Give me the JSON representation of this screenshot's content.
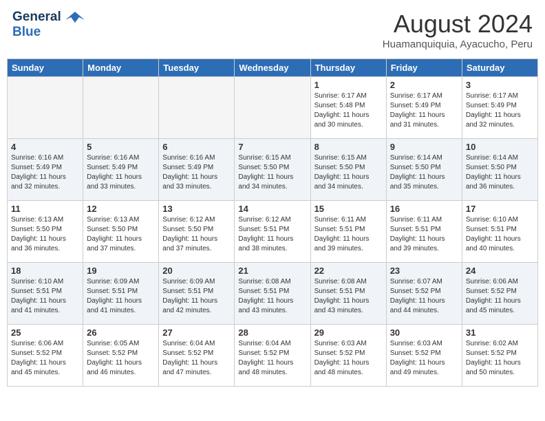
{
  "header": {
    "logo_line1": "General",
    "logo_line2": "Blue",
    "title": "August 2024",
    "subtitle": "Huamanquiquia, Ayacucho, Peru"
  },
  "calendar": {
    "headers": [
      "Sunday",
      "Monday",
      "Tuesday",
      "Wednesday",
      "Thursday",
      "Friday",
      "Saturday"
    ],
    "weeks": [
      [
        {
          "day": "",
          "info": ""
        },
        {
          "day": "",
          "info": ""
        },
        {
          "day": "",
          "info": ""
        },
        {
          "day": "",
          "info": ""
        },
        {
          "day": "1",
          "info": "Sunrise: 6:17 AM\nSunset: 5:48 PM\nDaylight: 11 hours and 30 minutes."
        },
        {
          "day": "2",
          "info": "Sunrise: 6:17 AM\nSunset: 5:49 PM\nDaylight: 11 hours and 31 minutes."
        },
        {
          "day": "3",
          "info": "Sunrise: 6:17 AM\nSunset: 5:49 PM\nDaylight: 11 hours and 32 minutes."
        }
      ],
      [
        {
          "day": "4",
          "info": "Sunrise: 6:16 AM\nSunset: 5:49 PM\nDaylight: 11 hours and 32 minutes."
        },
        {
          "day": "5",
          "info": "Sunrise: 6:16 AM\nSunset: 5:49 PM\nDaylight: 11 hours and 33 minutes."
        },
        {
          "day": "6",
          "info": "Sunrise: 6:16 AM\nSunset: 5:49 PM\nDaylight: 11 hours and 33 minutes."
        },
        {
          "day": "7",
          "info": "Sunrise: 6:15 AM\nSunset: 5:50 PM\nDaylight: 11 hours and 34 minutes."
        },
        {
          "day": "8",
          "info": "Sunrise: 6:15 AM\nSunset: 5:50 PM\nDaylight: 11 hours and 34 minutes."
        },
        {
          "day": "9",
          "info": "Sunrise: 6:14 AM\nSunset: 5:50 PM\nDaylight: 11 hours and 35 minutes."
        },
        {
          "day": "10",
          "info": "Sunrise: 6:14 AM\nSunset: 5:50 PM\nDaylight: 11 hours and 36 minutes."
        }
      ],
      [
        {
          "day": "11",
          "info": "Sunrise: 6:13 AM\nSunset: 5:50 PM\nDaylight: 11 hours and 36 minutes."
        },
        {
          "day": "12",
          "info": "Sunrise: 6:13 AM\nSunset: 5:50 PM\nDaylight: 11 hours and 37 minutes."
        },
        {
          "day": "13",
          "info": "Sunrise: 6:12 AM\nSunset: 5:50 PM\nDaylight: 11 hours and 37 minutes."
        },
        {
          "day": "14",
          "info": "Sunrise: 6:12 AM\nSunset: 5:51 PM\nDaylight: 11 hours and 38 minutes."
        },
        {
          "day": "15",
          "info": "Sunrise: 6:11 AM\nSunset: 5:51 PM\nDaylight: 11 hours and 39 minutes."
        },
        {
          "day": "16",
          "info": "Sunrise: 6:11 AM\nSunset: 5:51 PM\nDaylight: 11 hours and 39 minutes."
        },
        {
          "day": "17",
          "info": "Sunrise: 6:10 AM\nSunset: 5:51 PM\nDaylight: 11 hours and 40 minutes."
        }
      ],
      [
        {
          "day": "18",
          "info": "Sunrise: 6:10 AM\nSunset: 5:51 PM\nDaylight: 11 hours and 41 minutes."
        },
        {
          "day": "19",
          "info": "Sunrise: 6:09 AM\nSunset: 5:51 PM\nDaylight: 11 hours and 41 minutes."
        },
        {
          "day": "20",
          "info": "Sunrise: 6:09 AM\nSunset: 5:51 PM\nDaylight: 11 hours and 42 minutes."
        },
        {
          "day": "21",
          "info": "Sunrise: 6:08 AM\nSunset: 5:51 PM\nDaylight: 11 hours and 43 minutes."
        },
        {
          "day": "22",
          "info": "Sunrise: 6:08 AM\nSunset: 5:51 PM\nDaylight: 11 hours and 43 minutes."
        },
        {
          "day": "23",
          "info": "Sunrise: 6:07 AM\nSunset: 5:52 PM\nDaylight: 11 hours and 44 minutes."
        },
        {
          "day": "24",
          "info": "Sunrise: 6:06 AM\nSunset: 5:52 PM\nDaylight: 11 hours and 45 minutes."
        }
      ],
      [
        {
          "day": "25",
          "info": "Sunrise: 6:06 AM\nSunset: 5:52 PM\nDaylight: 11 hours and 45 minutes."
        },
        {
          "day": "26",
          "info": "Sunrise: 6:05 AM\nSunset: 5:52 PM\nDaylight: 11 hours and 46 minutes."
        },
        {
          "day": "27",
          "info": "Sunrise: 6:04 AM\nSunset: 5:52 PM\nDaylight: 11 hours and 47 minutes."
        },
        {
          "day": "28",
          "info": "Sunrise: 6:04 AM\nSunset: 5:52 PM\nDaylight: 11 hours and 48 minutes."
        },
        {
          "day": "29",
          "info": "Sunrise: 6:03 AM\nSunset: 5:52 PM\nDaylight: 11 hours and 48 minutes."
        },
        {
          "day": "30",
          "info": "Sunrise: 6:03 AM\nSunset: 5:52 PM\nDaylight: 11 hours and 49 minutes."
        },
        {
          "day": "31",
          "info": "Sunrise: 6:02 AM\nSunset: 5:52 PM\nDaylight: 11 hours and 50 minutes."
        }
      ]
    ]
  }
}
